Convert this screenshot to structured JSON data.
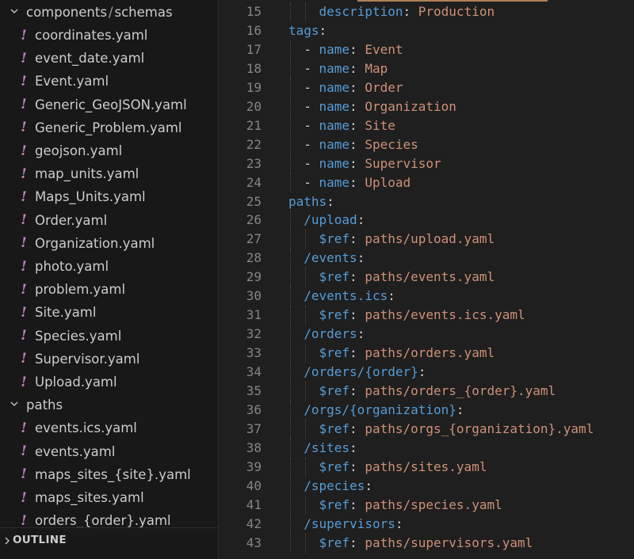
{
  "explorer": {
    "folders": {
      "schemas": {
        "parent": "components",
        "separator": "/",
        "name": "schemas"
      },
      "paths": {
        "name": "paths"
      }
    },
    "schema_files": [
      "coordinates.yaml",
      "event_date.yaml",
      "Event.yaml",
      "Generic_GeoJSON.yaml",
      "Generic_Problem.yaml",
      "geojson.yaml",
      "map_units.yaml",
      "Maps_Units.yaml",
      "Order.yaml",
      "Organization.yaml",
      "photo.yaml",
      "problem.yaml",
      "Site.yaml",
      "Species.yaml",
      "Supervisor.yaml",
      "Upload.yaml"
    ],
    "path_files": [
      "events.ics.yaml",
      "events.yaml",
      "maps_sites_{site}.yaml",
      "maps_sites.yaml",
      "orders_{order}.yaml"
    ],
    "file_icon_glyph": "!",
    "outline_label": "OUTLINE"
  },
  "editor": {
    "lines": [
      {
        "n": "15",
        "indent": 2,
        "key": "description",
        "val": "Production"
      },
      {
        "n": "16",
        "indent": 0,
        "key": "tags",
        "val": ""
      },
      {
        "n": "17",
        "indent": 1,
        "dash": true,
        "key": "name",
        "val": "Event"
      },
      {
        "n": "18",
        "indent": 1,
        "dash": true,
        "key": "name",
        "val": "Map"
      },
      {
        "n": "19",
        "indent": 1,
        "dash": true,
        "key": "name",
        "val": "Order"
      },
      {
        "n": "20",
        "indent": 1,
        "dash": true,
        "key": "name",
        "val": "Organization"
      },
      {
        "n": "21",
        "indent": 1,
        "dash": true,
        "key": "name",
        "val": "Site"
      },
      {
        "n": "22",
        "indent": 1,
        "dash": true,
        "key": "name",
        "val": "Species"
      },
      {
        "n": "23",
        "indent": 1,
        "dash": true,
        "key": "name",
        "val": "Supervisor"
      },
      {
        "n": "24",
        "indent": 1,
        "dash": true,
        "key": "name",
        "val": "Upload"
      },
      {
        "n": "25",
        "indent": 0,
        "key": "paths",
        "val": ""
      },
      {
        "n": "26",
        "indent": 1,
        "key": "/upload",
        "val": ""
      },
      {
        "n": "27",
        "indent": 2,
        "key": "$ref",
        "val": "paths/upload.yaml"
      },
      {
        "n": "28",
        "indent": 1,
        "key": "/events",
        "val": ""
      },
      {
        "n": "29",
        "indent": 2,
        "key": "$ref",
        "val": "paths/events.yaml"
      },
      {
        "n": "30",
        "indent": 1,
        "key": "/events.ics",
        "val": ""
      },
      {
        "n": "31",
        "indent": 2,
        "key": "$ref",
        "val": "paths/events.ics.yaml"
      },
      {
        "n": "32",
        "indent": 1,
        "key": "/orders",
        "val": ""
      },
      {
        "n": "33",
        "indent": 2,
        "key": "$ref",
        "val": "paths/orders.yaml"
      },
      {
        "n": "34",
        "indent": 1,
        "key": "/orders/{order}",
        "val": ""
      },
      {
        "n": "35",
        "indent": 2,
        "key": "$ref",
        "val": "paths/orders_{order}.yaml"
      },
      {
        "n": "36",
        "indent": 1,
        "key": "/orgs/{organization}",
        "val": ""
      },
      {
        "n": "37",
        "indent": 2,
        "key": "$ref",
        "val": "paths/orgs_{organization}.yaml"
      },
      {
        "n": "38",
        "indent": 1,
        "key": "/sites",
        "val": ""
      },
      {
        "n": "39",
        "indent": 2,
        "key": "$ref",
        "val": "paths/sites.yaml"
      },
      {
        "n": "40",
        "indent": 1,
        "key": "/species",
        "val": ""
      },
      {
        "n": "41",
        "indent": 2,
        "key": "$ref",
        "val": "paths/species.yaml"
      },
      {
        "n": "42",
        "indent": 1,
        "key": "/supervisors",
        "val": ""
      },
      {
        "n": "43",
        "indent": 2,
        "key": "$ref",
        "val": "paths/supervisors.yaml"
      }
    ],
    "colors": {
      "key": "#569cd6",
      "value": "#ce9178",
      "punct": "#d4d4d4",
      "line_number": "#858585"
    }
  }
}
